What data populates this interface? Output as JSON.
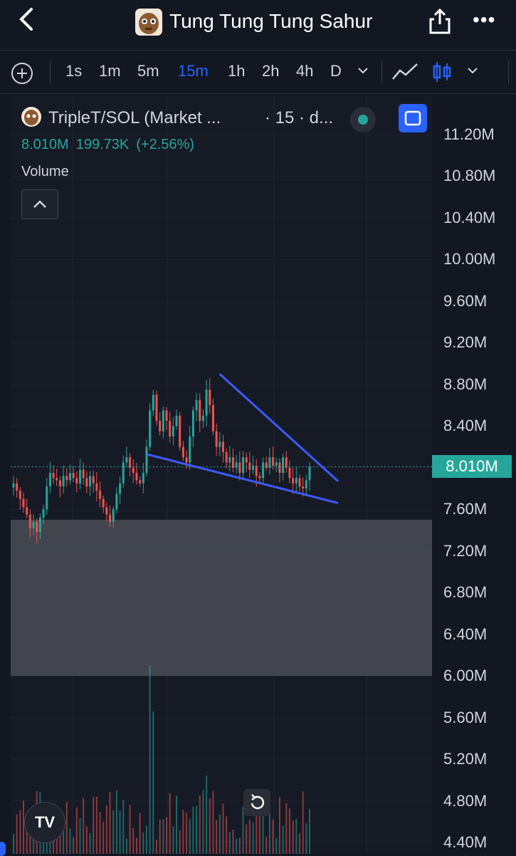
{
  "nav": {
    "title": "Tung Tung Tung Sahur"
  },
  "toolbar": {
    "timeframes": [
      "1s",
      "1m",
      "5m",
      "15m",
      "1h",
      "2h",
      "4h",
      "D"
    ],
    "active_timeframe": "15m"
  },
  "legend": {
    "symbol": "TripleT/SOL (Market ...",
    "interval": "· 15 · d...",
    "price": "8.010M",
    "change": "199.73K",
    "change_pct": "(+2.56%)",
    "volume_label": "Volume"
  },
  "axis": {
    "ticks": [
      "11.20M",
      "10.80M",
      "10.40M",
      "10.00M",
      "9.60M",
      "9.20M",
      "8.80M",
      "8.40M",
      "8.010M",
      "7.60M",
      "7.20M",
      "6.80M",
      "6.40M",
      "6.00M",
      "5.60M",
      "5.20M",
      "4.80M",
      "4.40M"
    ],
    "current_price": "8.010M"
  },
  "colors": {
    "up": "#26a69a",
    "down": "#ef5350",
    "accent": "#2962ff",
    "trendline": "#3d5afe",
    "zone": "#4a4d55"
  },
  "chart_data": {
    "type": "candlestick",
    "y_range": [
      4.4,
      11.2
    ],
    "y_unit": "M",
    "current_price": 8.01,
    "zone": [
      6.0,
      7.5
    ],
    "trendlines": [
      {
        "from_price": 8.9,
        "to_price": 7.87
      },
      {
        "from_price": 8.13,
        "to_price": 7.66
      }
    ],
    "closes": [
      7.85,
      7.78,
      7.7,
      7.62,
      7.55,
      7.42,
      7.48,
      7.38,
      7.52,
      7.6,
      7.82,
      7.95,
      7.9,
      7.88,
      7.82,
      7.92,
      7.88,
      7.95,
      7.9,
      7.85,
      7.98,
      7.9,
      7.82,
      7.92,
      7.85,
      7.78,
      7.7,
      7.62,
      7.55,
      7.48,
      7.6,
      7.75,
      7.85,
      8.05,
      8.1,
      8.0,
      7.95,
      7.88,
      7.85,
      7.95,
      8.2,
      8.55,
      8.7,
      8.45,
      8.35,
      8.55,
      8.45,
      8.3,
      8.4,
      8.5,
      8.2,
      8.1,
      8.05,
      8.3,
      8.55,
      8.65,
      8.45,
      8.5,
      8.75,
      8.6,
      8.35,
      8.2,
      8.25,
      8.15,
      8.05,
      8.1,
      8.0,
      8.05,
      7.95,
      8.1,
      8.05,
      7.98,
      8.02,
      7.92,
      7.9,
      8.05,
      8.0,
      8.1,
      8.02,
      8.05,
      7.95,
      8.1,
      8.0,
      7.9,
      7.85,
      7.9,
      7.82,
      7.8,
      7.88,
      8.01
    ]
  }
}
